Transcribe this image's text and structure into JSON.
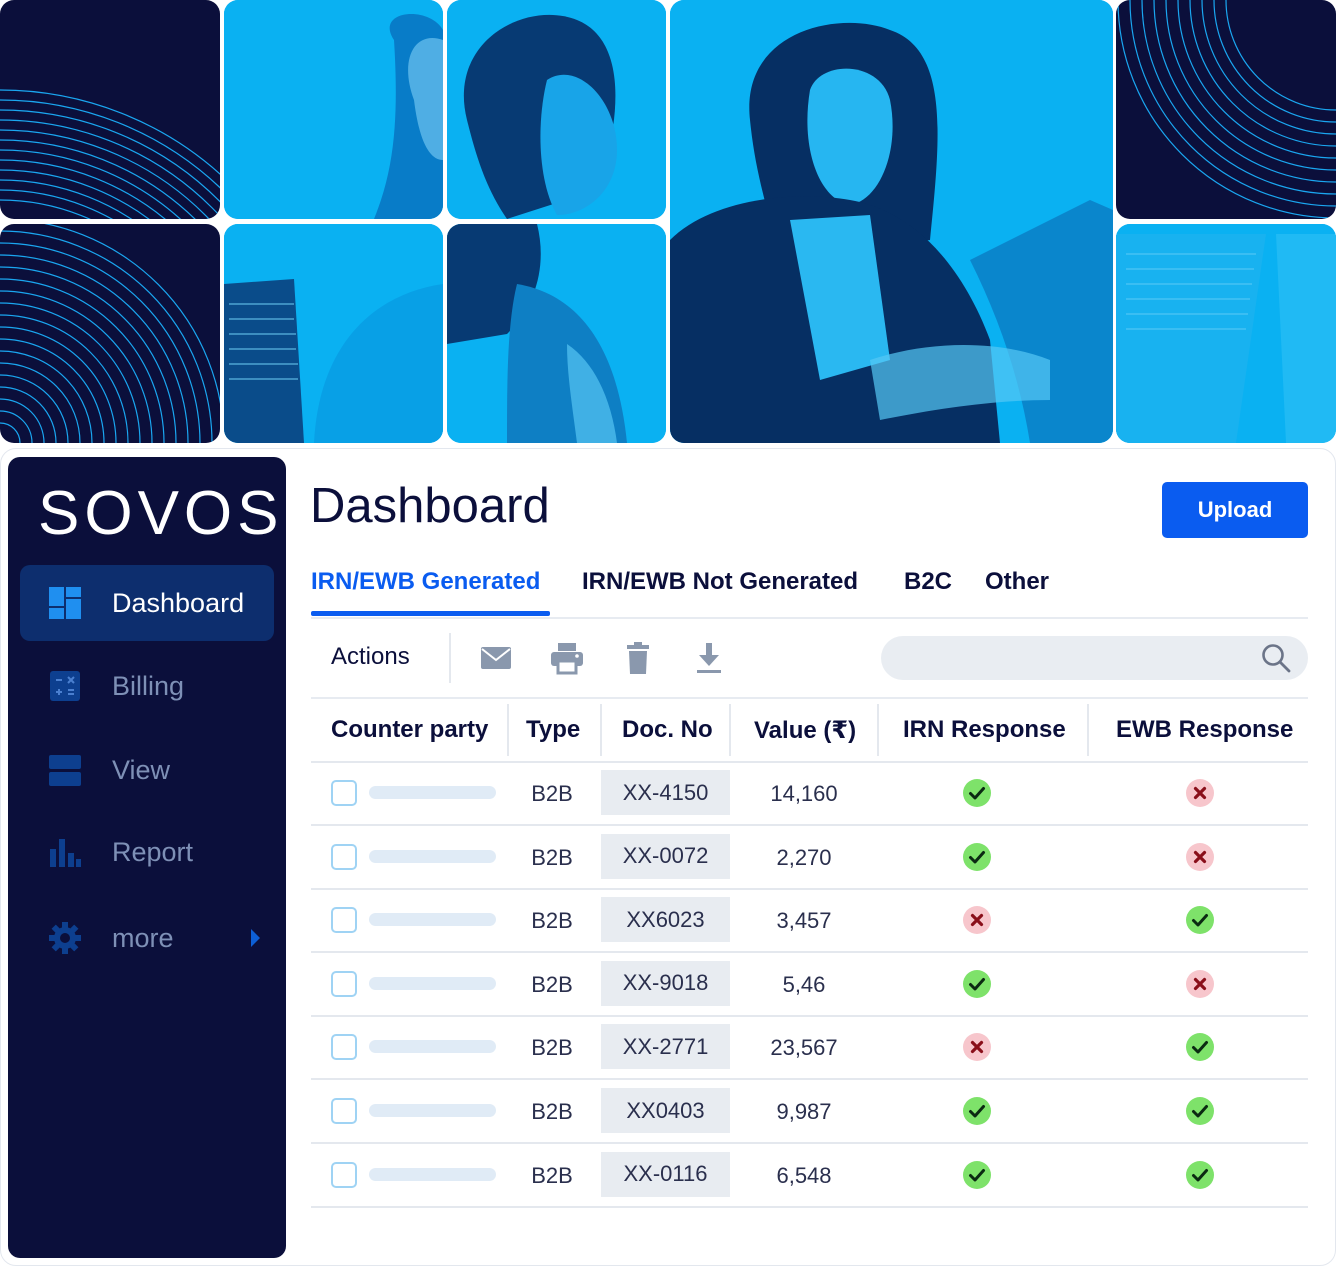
{
  "brand": {
    "logo": "SOVOS"
  },
  "sidebar": {
    "items": [
      {
        "label": "Dashboard",
        "icon": "dashboard-icon",
        "active": true
      },
      {
        "label": "Billing",
        "icon": "calculator-icon"
      },
      {
        "label": "View",
        "icon": "view-icon"
      },
      {
        "label": "Report",
        "icon": "report-icon"
      },
      {
        "label": "more",
        "icon": "gear-icon"
      }
    ]
  },
  "header": {
    "title": "Dashboard",
    "upload_label": "Upload"
  },
  "tabs": [
    {
      "label": "IRN/EWB Generated",
      "active": true
    },
    {
      "label": "IRN/EWB Not Generated"
    },
    {
      "label": "B2C"
    },
    {
      "label": "Other"
    }
  ],
  "actions": {
    "label": "Actions",
    "icons": [
      "mail-icon",
      "print-icon",
      "delete-icon",
      "download-icon"
    ]
  },
  "search": {
    "placeholder": ""
  },
  "table": {
    "columns": [
      "Counter party",
      "Type",
      "Doc. No",
      "Value (₹)",
      "IRN Response",
      "EWB Response"
    ],
    "rows": [
      {
        "type": "B2B",
        "doc": "XX-4150",
        "value": "14,160",
        "irn": true,
        "ewb": false
      },
      {
        "type": "B2B",
        "doc": "XX-0072",
        "value": "2,270",
        "irn": true,
        "ewb": false
      },
      {
        "type": "B2B",
        "doc": "XX6023",
        "value": "3,457",
        "irn": false,
        "ewb": true
      },
      {
        "type": "B2B",
        "doc": "XX-9018",
        "value": "5,46",
        "irn": true,
        "ewb": false
      },
      {
        "type": "B2B",
        "doc": "XX-2771",
        "value": "23,567",
        "irn": false,
        "ewb": true
      },
      {
        "type": "B2B",
        "doc": "XX0403",
        "value": "9,987",
        "irn": true,
        "ewb": true
      },
      {
        "type": "B2B",
        "doc": "XX-0116",
        "value": "6,548",
        "irn": true,
        "ewb": true
      }
    ]
  },
  "colors": {
    "navy": "#0b0f3b",
    "accent": "#0a5cf0",
    "hero_cyan": "#04a9ee",
    "success": "#7ee26a",
    "error": "#f7c6cc"
  }
}
